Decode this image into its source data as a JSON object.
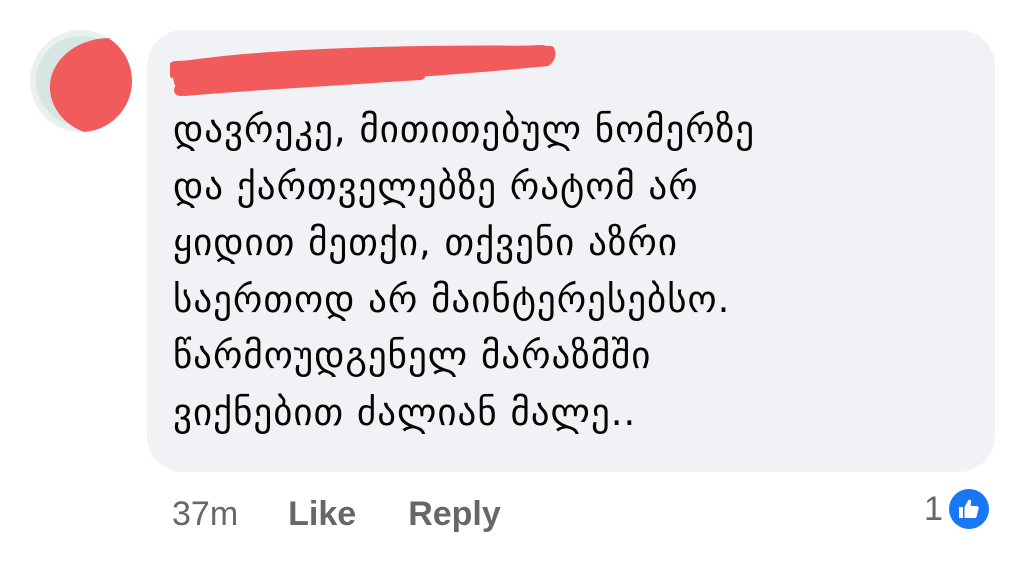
{
  "author": {
    "name": "",
    "redacted": true
  },
  "comment": {
    "lines": [
      "დავრეკე, მითითებულ ნომერზე",
      "და ქართველებზე რატომ არ",
      "ყიდით მეთქი, თქვენი აზრი",
      "საერთოდ არ მაინტერესებსო.",
      "წარმოუდგენელ მარაზმში",
      "ვიქნებით ძალიან მალე.."
    ]
  },
  "footer": {
    "time": "37m",
    "like_label": "Like",
    "reply_label": "Reply"
  },
  "reactions": {
    "count": "1",
    "icon": "thumbs-up-icon",
    "icon_color": "#1877f2"
  },
  "colors": {
    "bubble": "#f0f2f5",
    "redaction": "#f25b5b",
    "muted_text": "#65676b",
    "text": "#050505"
  }
}
